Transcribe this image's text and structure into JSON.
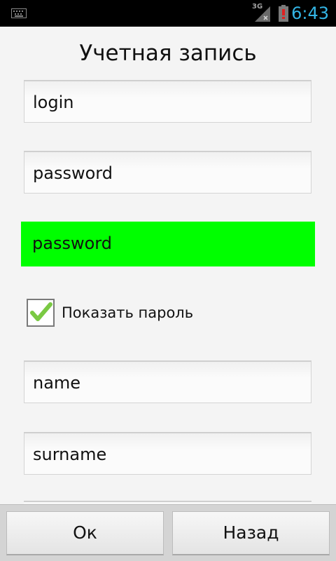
{
  "status_bar": {
    "network_type": "3G",
    "time": "6:43",
    "icons": [
      "keyboard-icon",
      "signal-icon",
      "battery-alert-icon"
    ]
  },
  "title": "Учетная запись",
  "fields": {
    "login": "login",
    "password": "password",
    "password_confirm": "password",
    "name": "name",
    "surname": "surname"
  },
  "show_password": {
    "label": "Показать пароль",
    "checked": true
  },
  "buttons": {
    "ok": "Ок",
    "back": "Назад"
  },
  "colors": {
    "accent": "#33b5e5",
    "active_field": "#00ff00",
    "checkmark": "#7ac943"
  }
}
